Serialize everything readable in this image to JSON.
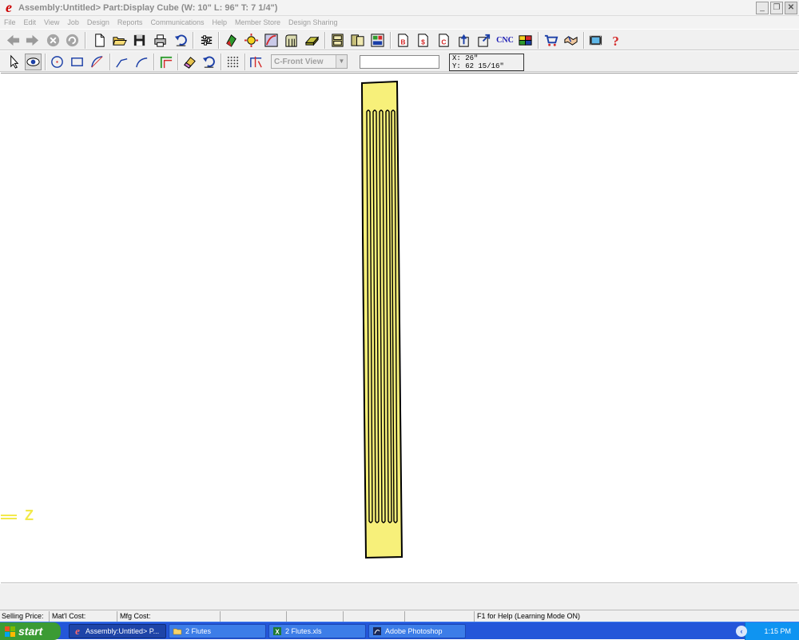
{
  "window": {
    "title": "Assembly:Untitled> Part:Display Cube (W: 10\" L: 96\" T: 7 1/4\")",
    "controls": {
      "minimize": "_",
      "restore": "❐",
      "close": "✕"
    }
  },
  "menu": [
    "File",
    "Edit",
    "View",
    "Job",
    "Design",
    "Reports",
    "Communications",
    "Help",
    "Member Store",
    "Design Sharing"
  ],
  "toolbar": {
    "cnc_label": "CNC",
    "view_selector": "C-Front View",
    "coordinates": {
      "x": "X: 26\"",
      "y": "Y: 62 15/16\""
    }
  },
  "canvas": {
    "axis_label": "Z",
    "part_color": "#f7f07a"
  },
  "status": {
    "selling_price": "Selling Price:",
    "material_cost": "Mat'l Cost:",
    "mfg_cost": "Mfg Cost:",
    "help_hint": "F1 for Help (Learning Mode ON)"
  },
  "taskbar": {
    "start": "start",
    "tasks": [
      {
        "label": "Assembly:Untitled> P...",
        "icon": "app-e-icon"
      },
      {
        "label": "2 Flutes",
        "icon": "folder-icon"
      },
      {
        "label": "2 Flutes.xls",
        "icon": "excel-icon"
      },
      {
        "label": "Adobe Photoshop",
        "icon": "photoshop-icon"
      }
    ],
    "clock": "1:15 PM"
  }
}
